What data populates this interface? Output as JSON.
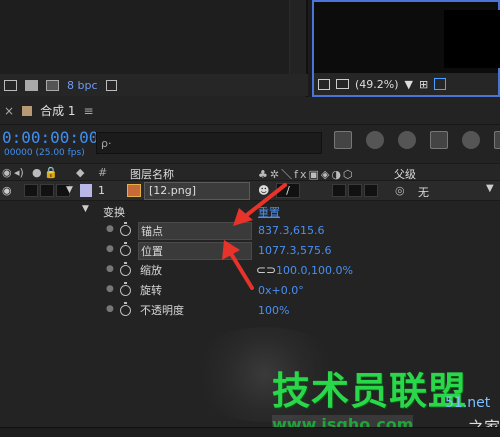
{
  "project_panel": {
    "bpc_label": "8 bpc"
  },
  "viewer": {
    "zoom": "(49.2%)"
  },
  "timeline": {
    "tab_close": "×",
    "tab_name": "合成 1",
    "tab_menu": "≡",
    "timecode": "0:00:00:00",
    "frame_info": "00000 (25.00 fps)",
    "search_placeholder": "ρ·",
    "columns": {
      "num": "#",
      "name": "图层名称",
      "switches": "♣✲＼fx▣◈◑⬡",
      "parent": "父级"
    },
    "layer": {
      "num": "1",
      "name": "[12.png]",
      "parent": "无",
      "spiral": "◎"
    },
    "transform": {
      "label": "变换",
      "reset": "重置"
    },
    "properties": [
      {
        "name": "锚点",
        "value": "837.3,615.6",
        "highlighted": true
      },
      {
        "name": "位置",
        "value": "1077.3,575.6",
        "highlighted": true
      },
      {
        "name": "缩放",
        "value": "100.0,100.0%",
        "highlighted": false
      },
      {
        "name": "旋转",
        "value": "0x+0.0°",
        "highlighted": false
      },
      {
        "name": "不透明度",
        "value": "100%",
        "highlighted": false
      }
    ]
  },
  "watermark": {
    "main": "技术员联盟",
    "url": "www.jsgho.com",
    "net": "51.net",
    "zhi": "之家"
  },
  "colors": {
    "accent": "#3f8ff3",
    "arrow": "#e8332a",
    "watermark": "#2ad64a"
  }
}
